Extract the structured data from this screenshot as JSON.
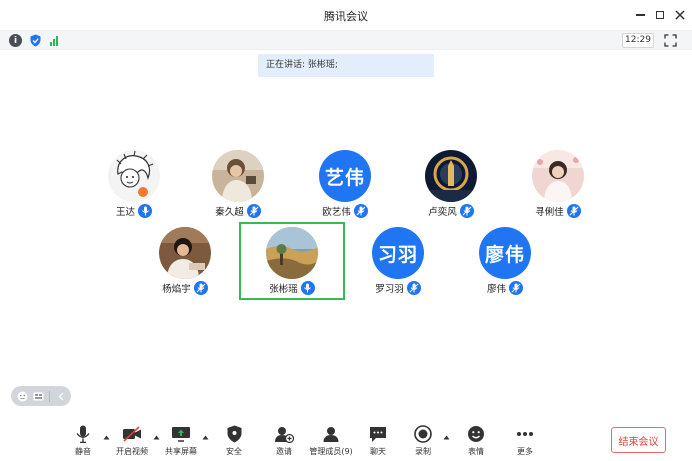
{
  "window": {
    "title": "腾讯会议"
  },
  "statusbar": {
    "time": "12:29",
    "signal_level": 3
  },
  "speaking_banner": {
    "text": "正在讲话: 张彬瑶;"
  },
  "participants": [
    {
      "name": "王达",
      "avatar": "cartoon-drawing",
      "mic": "active"
    },
    {
      "name": "秦久超",
      "avatar": "photo-person",
      "mic": "muted"
    },
    {
      "name": "欧艺伟",
      "avatar_text": "艺伟",
      "mic": "muted"
    },
    {
      "name": "卢奕风",
      "avatar": "photo-night",
      "mic": "muted"
    },
    {
      "name": "寻俐佳",
      "avatar": "photo-girl",
      "mic": "muted"
    },
    {
      "name": "杨焰宇",
      "avatar": "photo-child",
      "mic": "muted"
    },
    {
      "name": "张彬瑶",
      "avatar": "photo-painting",
      "mic": "active",
      "speaking": true
    },
    {
      "name": "罗习羽",
      "avatar_text": "习羽",
      "mic": "muted"
    },
    {
      "name": "廖伟",
      "avatar_text": "廖伟",
      "mic": "muted"
    }
  ],
  "toolbar": {
    "mute": "静音",
    "video": "开启视频",
    "share": "共享屏幕",
    "security": "安全",
    "invite": "邀请",
    "manage": "管理成员(9)",
    "chat": "聊天",
    "record": "录制",
    "reactions": "表情",
    "more": "更多",
    "end": "结束会议"
  },
  "colors": {
    "accent": "#1f75f2",
    "active_frame": "#37b956",
    "end": "#e0413a",
    "signal": "#2db55d"
  }
}
